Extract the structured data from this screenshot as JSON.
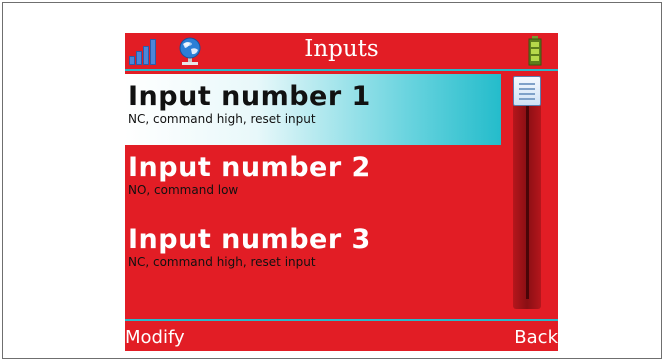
{
  "header": {
    "title": "Inputs",
    "icons": {
      "signal": "signal-strength-icon",
      "network": "network-globe-icon",
      "battery": "battery-icon"
    }
  },
  "colors": {
    "background": "#e21d25",
    "accent": "#2bb8c8",
    "selected": "#24bccb"
  },
  "list": {
    "selected_index": 0,
    "items": [
      {
        "title": "Input number 1",
        "subtitle": "NC, command high, reset input"
      },
      {
        "title": "Input number 2",
        "subtitle": "NO, command low"
      },
      {
        "title": "Input number 3",
        "subtitle": "NC, command high, reset input"
      }
    ]
  },
  "footer": {
    "left_label": "Modify",
    "right_label": "Back"
  }
}
